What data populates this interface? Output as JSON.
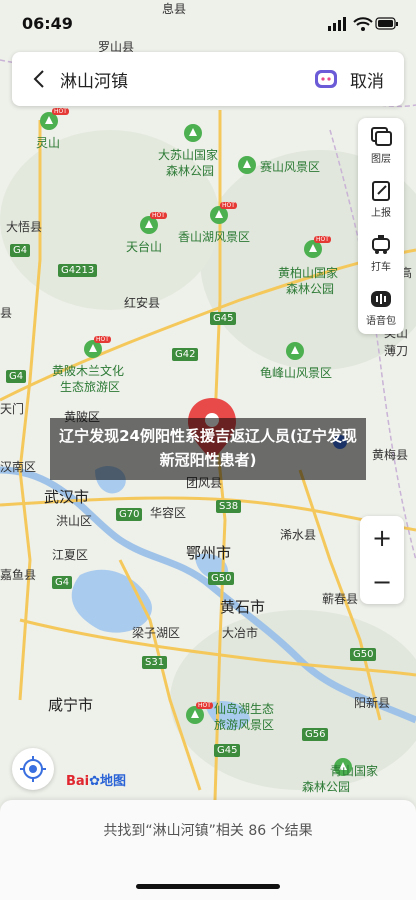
{
  "status_bar": {
    "time": "06:49"
  },
  "search": {
    "query": "淋山河镇",
    "cancel_label": "取消"
  },
  "tools": [
    {
      "label": "图层",
      "icon": "layers-icon"
    },
    {
      "label": "上报",
      "icon": "report-icon"
    },
    {
      "label": "打车",
      "icon": "taxi-icon"
    },
    {
      "label": "语音包",
      "icon": "voice-pack-icon"
    }
  ],
  "zoom": {
    "in_label": "+",
    "out_label": "−"
  },
  "logo": {
    "text_bai": "Bai",
    "text_du": "地图"
  },
  "result": {
    "text": "共找到“淋山河镇”相关 86 个结果"
  },
  "overlay": {
    "title": "辽宁发现24例阳性系援吉返辽人员(辽宁发现新冠阳性患者)"
  },
  "map_labels": {
    "luoshan": "罗山县",
    "yingshan_top": "息县",
    "lingshan": "灵山",
    "dasu": "大苏山国家",
    "dasu2": "森林公园",
    "saishan": "赛山风景区",
    "dawu": "大悟县",
    "tiantai": "天台山",
    "xiangshan": "香山湖风景区",
    "huanggang_shan": "黄柏山国家",
    "huanggang_shan2": "森林公园",
    "hongan": "红安县",
    "huangpi_mulan": "黄陂木兰文化",
    "huangpi_mulan2": "生态旅游区",
    "guifeng": "龟峰山风景区",
    "huangpi": "黄陂区",
    "tuanfeng": "团风县",
    "wuhan": "武汉市",
    "hongshan": "洪山区",
    "huarong": "华容区",
    "xishui": "浠水县",
    "jiangxia": "江夏区",
    "ezhou": "鄂州市",
    "huangshi": "黄石市",
    "qichun": "蕲春县",
    "liangzihu": "梁子湖区",
    "daye": "大冶市",
    "xianning": "咸宁市",
    "xiandao": "仙岛湖生态",
    "xiandao2": "旅游风景区",
    "qingshan": "青山国家",
    "qingshan2": "森林公园",
    "yangxin": "阳新县",
    "jiayu": "嘉鱼县",
    "hannan": "汉南区",
    "yingshan": "英山",
    "bomao": "薄刀",
    "gaojin": "高",
    "huangmei": "黄梅县",
    "tianmen": "天门",
    "liang": "县"
  },
  "roads": [
    "G4",
    "G4213",
    "G45",
    "G42",
    "G4",
    "G70",
    "S38",
    "G50",
    "S31",
    "G45",
    "G56",
    "G50",
    "G4"
  ],
  "hot_label": "HOT"
}
